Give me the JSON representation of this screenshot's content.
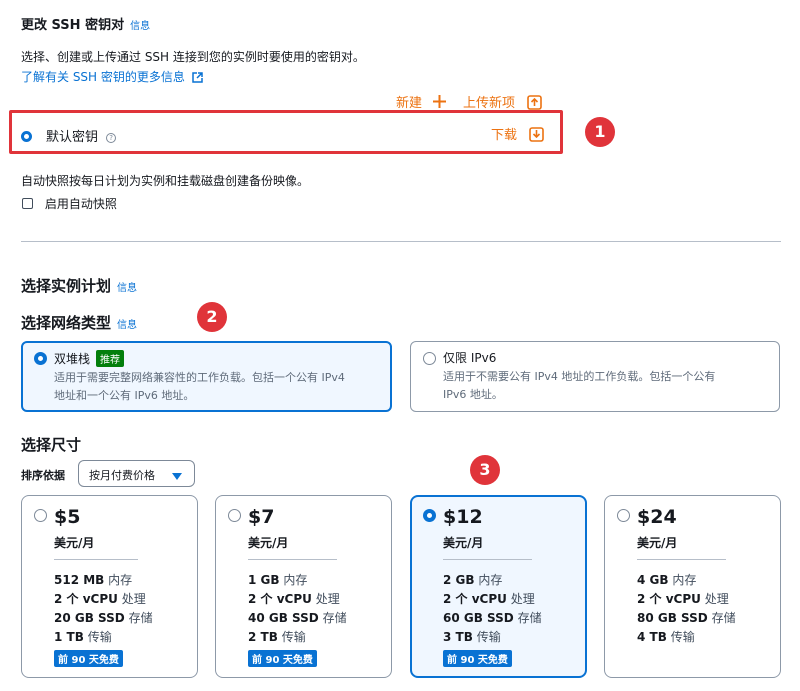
{
  "ssh": {
    "title": "更改 SSH 密钥对",
    "info": "信息",
    "description": "选择、创建或上传通过 SSH 连接到您的实例时要使用的密钥对。",
    "learn_more": "了解有关 SSH 密钥的更多信息",
    "new_label": "新建",
    "upload_label": "上传新项",
    "default_key": "默认密钥",
    "download_label": "下载",
    "annotation": "1"
  },
  "snapshot": {
    "description": "自动快照按每日计划为实例和挂载磁盘创建备份映像。",
    "checkbox_label": "启用自动快照"
  },
  "plan": {
    "title": "选择实例计划",
    "info": "信息"
  },
  "network": {
    "title": "选择网络类型",
    "info": "信息",
    "annotation": "2",
    "options": [
      {
        "label": "双堆栈",
        "badge": "推荐",
        "desc1": "适用于需要完整网络兼容性的工作负载。包括一个公有 IPv4",
        "desc2": "地址和一个公有 IPv6 地址。",
        "selected": true
      },
      {
        "label": "仅限 IPv6",
        "desc1": "适用于不需要公有 IPv4 地址的工作负载。包括一个公有",
        "desc2": "IPv6 地址。",
        "selected": false
      }
    ]
  },
  "size": {
    "title": "选择尺寸",
    "sort_label": "排序依据",
    "sort_value": "按月付费价格",
    "annotation": "3",
    "cards": [
      {
        "price": "$5",
        "unit": "美元/月",
        "mem_v": "512 MB",
        "mem_l": "内存",
        "cpu_v": "2 个 vCPU",
        "cpu_l": "处理",
        "ssd_v": "20 GB SSD",
        "ssd_l": "存储",
        "tx_v": "1 TB",
        "tx_l": "传输",
        "free": "前 90 天免费",
        "selected": false
      },
      {
        "price": "$7",
        "unit": "美元/月",
        "mem_v": "1 GB",
        "mem_l": "内存",
        "cpu_v": "2 个 vCPU",
        "cpu_l": "处理",
        "ssd_v": "40 GB SSD",
        "ssd_l": "存储",
        "tx_v": "2 TB",
        "tx_l": "传输",
        "free": "前 90 天免费",
        "selected": false
      },
      {
        "price": "$12",
        "unit": "美元/月",
        "mem_v": "2 GB",
        "mem_l": "内存",
        "cpu_v": "2 个 vCPU",
        "cpu_l": "处理",
        "ssd_v": "60 GB SSD",
        "ssd_l": "存储",
        "tx_v": "3 TB",
        "tx_l": "传输",
        "free": "前 90 天免费",
        "selected": true
      },
      {
        "price": "$24",
        "unit": "美元/月",
        "mem_v": "4 GB",
        "mem_l": "内存",
        "cpu_v": "2 个 vCPU",
        "cpu_l": "处理",
        "ssd_v": "80 GB SSD",
        "ssd_l": "存储",
        "tx_v": "4 TB",
        "tx_l": "传输",
        "selected": false
      }
    ]
  },
  "colors": {
    "accent": "#0972d3",
    "orange": "#ec7211",
    "annotation_red": "#e0343a",
    "recommended_green": "#037f0c"
  },
  "icons": [
    "external-link-icon",
    "plus-icon",
    "upload-icon",
    "download-icon",
    "help-icon",
    "caret-down-icon"
  ]
}
